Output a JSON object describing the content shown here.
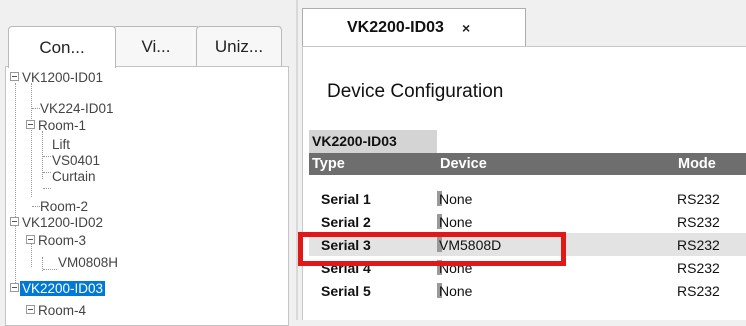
{
  "left_tabs": [
    "Con...",
    "Vi...",
    "Uniz..."
  ],
  "tree": [
    {
      "label": "VK1200-ID01",
      "toggle": true
    },
    {
      "label": "VK224-ID01",
      "toggle": false
    },
    {
      "label": "Room-1",
      "toggle": true
    },
    {
      "label": "Lift",
      "toggle": false
    },
    {
      "label": "VS0401",
      "toggle": false
    },
    {
      "label": "Curtain",
      "toggle": false
    },
    {
      "label": "Room-2",
      "toggle": false
    },
    {
      "label": "VK1200-ID02",
      "toggle": true
    },
    {
      "label": "Room-3",
      "toggle": true
    },
    {
      "label": "VM0808H",
      "toggle": false
    },
    {
      "label": "VK2200-ID03",
      "toggle": true,
      "selected": true
    },
    {
      "label": "Room-4",
      "toggle": true
    }
  ],
  "document_tab": {
    "title": "VK2200-ID03",
    "close": "×"
  },
  "page": {
    "heading": "Device Configuration"
  },
  "table": {
    "caption": "VK2200-ID03",
    "columns": [
      "Type",
      "Device",
      "Mode"
    ],
    "rows": [
      {
        "type": "Serial 1",
        "device": "None",
        "mode": "RS232"
      },
      {
        "type": "Serial 2",
        "device": "None",
        "mode": "RS232"
      },
      {
        "type": "Serial 3",
        "device": "VM5808D",
        "mode": "RS232",
        "highlighted": true
      },
      {
        "type": "Serial 4",
        "device": "None",
        "mode": "RS232"
      },
      {
        "type": "Serial 5",
        "device": "None",
        "mode": "RS232"
      }
    ]
  },
  "colors": {
    "selection": "#0078d7",
    "header_bg": "#6e6e6e",
    "callout": "#e01818"
  }
}
